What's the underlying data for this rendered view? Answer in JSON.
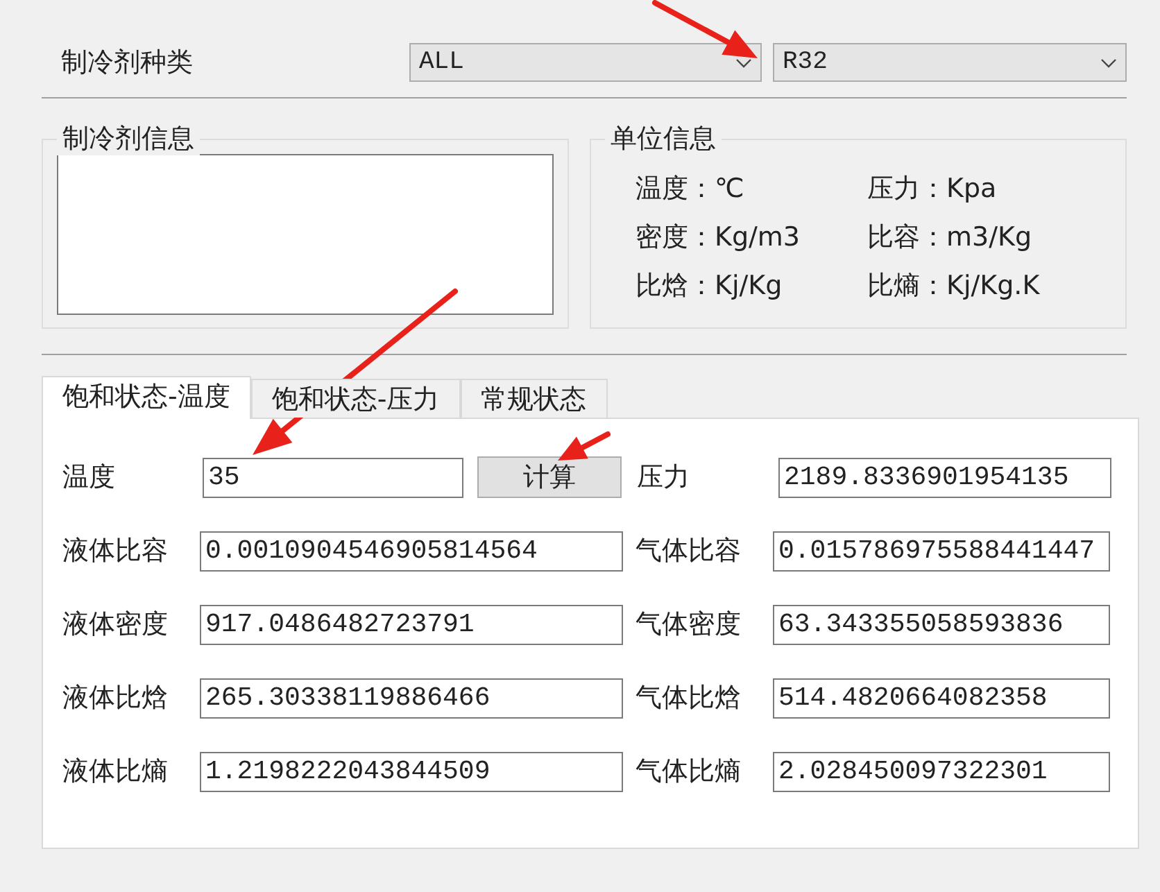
{
  "refrigerant_type": {
    "label": "制冷剂种类",
    "category": "ALL",
    "refrigerant": "R32"
  },
  "refrigerant_info": {
    "title": "制冷剂信息"
  },
  "unit_info": {
    "title": "单位信息",
    "items": [
      "温度：℃",
      "压力：Kpa",
      "密度：Kg/m3",
      "比容：m3/Kg",
      "比焓：Kj/Kg",
      "比熵：Kj/Kg.K"
    ]
  },
  "tabs": [
    {
      "label": "饱和状态-温度",
      "selected": true
    },
    {
      "label": "饱和状态-压力",
      "selected": false
    },
    {
      "label": "常规状态",
      "selected": false
    }
  ],
  "input": {
    "label": "温度",
    "value": "35"
  },
  "button": "计算",
  "pressure": {
    "label": "压力",
    "value": "2189.8336901954135"
  },
  "rows": [
    {
      "liquid": {
        "label": "液体比容",
        "value": "0.0010904546905814564"
      },
      "gas": {
        "label": "气体比容",
        "value": "0.015786975588441447"
      }
    },
    {
      "liquid": {
        "label": "液体密度",
        "value": "917.0486482723791"
      },
      "gas": {
        "label": "气体密度",
        "value": "63.343355058593836"
      }
    },
    {
      "liquid": {
        "label": "液体比焓",
        "value": "265.30338119886466"
      },
      "gas": {
        "label": "气体比焓",
        "value": "514.4820664082358"
      }
    },
    {
      "liquid": {
        "label": "液体比熵",
        "value": "1.2198222043844509"
      },
      "gas": {
        "label": "气体比熵",
        "value": "2.028450097322301"
      }
    }
  ]
}
